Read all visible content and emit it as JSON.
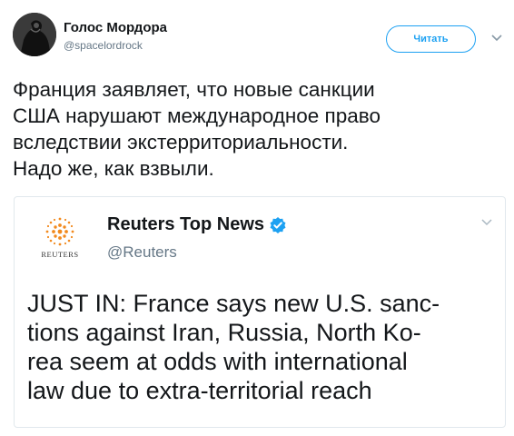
{
  "author": {
    "name": "Голос Мордора",
    "handle": "@spacelordrock"
  },
  "follow_label": "Читать",
  "tweet": {
    "text": "Франция заявляет, что новые санкции\nСША нарушают международное право\nвследствии экстерриториальности.\nНадо же, как взвыли."
  },
  "quoted_tweet": {
    "logo_wordmark": "REUTERS",
    "name": "Reuters Top News",
    "handle": "@Reuters",
    "text": "JUST IN: France says new U.S. sanc-\ntions against Iran, Russia, North Ko-\nrea seem at odds with international\nlaw due to extra-territorial reach"
  },
  "colors": {
    "accent": "#1da1f2",
    "reuters_orange": "#f28a1e",
    "text": "#14171a",
    "muted": "#657786"
  }
}
